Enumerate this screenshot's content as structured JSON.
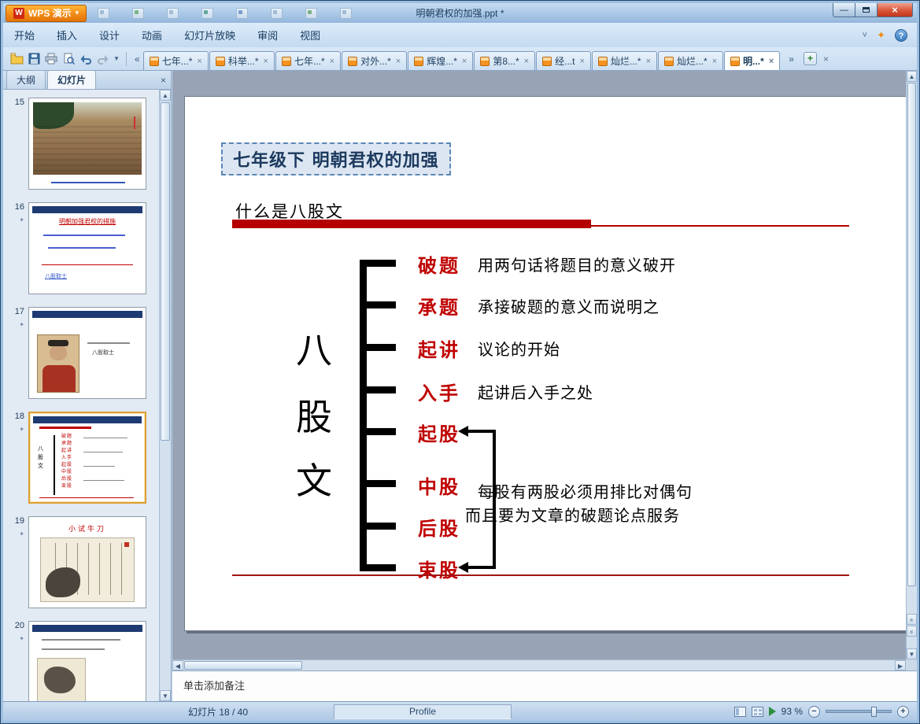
{
  "icons": {
    "close": "×",
    "minimize": "—",
    "dropdown": "▾",
    "collapse": "˅",
    "promo": "✦",
    "help": "?",
    "scroll_left": "«",
    "scroll_right": "»",
    "new_tab": "+",
    "up": "▲",
    "down": "▼",
    "left": "◀",
    "right": "▶",
    "double_prev": "«",
    "double_next": "»",
    "anim_star": "✦",
    "zoom_out": "−",
    "zoom_in": "+"
  },
  "titlebar": {
    "app_button": "WPS 演示",
    "title": "明朝君权的加强.ppt *"
  },
  "menu": {
    "items": [
      {
        "label": "开始"
      },
      {
        "label": "插入"
      },
      {
        "label": "设计"
      },
      {
        "label": "动画"
      },
      {
        "label": "幻灯片放映"
      },
      {
        "label": "审阅"
      },
      {
        "label": "视图"
      }
    ]
  },
  "doc_tabs": [
    {
      "label": "七年...*"
    },
    {
      "label": "科举...*"
    },
    {
      "label": "七年...*"
    },
    {
      "label": "对外...*"
    },
    {
      "label": "辉煌...*"
    },
    {
      "label": "第8...*"
    },
    {
      "label": "经...t"
    },
    {
      "label": "灿烂...*"
    },
    {
      "label": "灿烂...*"
    },
    {
      "label": "明...*"
    }
  ],
  "slide_panel": {
    "outline_tab": "大纲",
    "slides_tab": "幻灯片",
    "thumbnails": [
      {
        "num": "15"
      },
      {
        "num": "16",
        "title": "明朝加强君权的措施",
        "link": "八股取士"
      },
      {
        "num": "17",
        "caption": "八股取士"
      },
      {
        "num": "18"
      },
      {
        "num": "19",
        "title": "小试牛刀"
      },
      {
        "num": "20"
      }
    ]
  },
  "slide": {
    "title_box": "七年级下 明朝君权的加强",
    "heading": "什么是八股文",
    "vertical_label": [
      "八",
      "股",
      "文"
    ],
    "items": [
      {
        "term": "破题",
        "desc": "用两句话将题目的意义破开"
      },
      {
        "term": "承题",
        "desc": "承接破题的意义而说明之"
      },
      {
        "term": "起讲",
        "desc": "议论的开始"
      },
      {
        "term": "入手",
        "desc": "起讲后入手之处"
      },
      {
        "term": "起股",
        "desc": ""
      },
      {
        "term": "中股",
        "desc": ""
      },
      {
        "term": "后股",
        "desc": ""
      },
      {
        "term": "束股",
        "desc": ""
      }
    ],
    "group_note_line1": "每股有两股必须用排比对偶句",
    "group_note_line2": "而且要为文章的破题论点服务"
  },
  "notes": {
    "placeholder": "单击添加备注"
  },
  "statusbar": {
    "slide_indicator": "幻灯片 18 / 40",
    "profile": "Profile",
    "zoom_level": "93 %"
  }
}
